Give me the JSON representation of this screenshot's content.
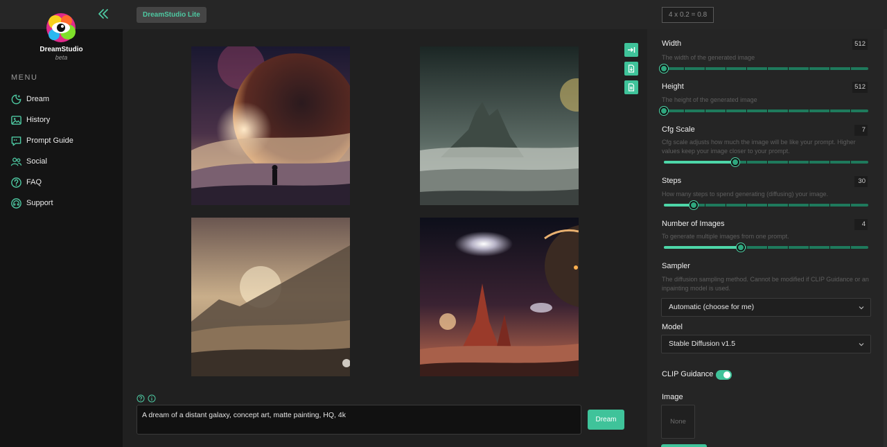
{
  "sidebar": {
    "brand": "DreamStudio",
    "brand_sub": "beta",
    "menu_label": "MENU",
    "items": [
      {
        "label": "Dream",
        "icon": "dream-icon"
      },
      {
        "label": "History",
        "icon": "history-icon"
      },
      {
        "label": "Prompt Guide",
        "icon": "prompt-guide-icon"
      },
      {
        "label": "Social",
        "icon": "social-icon"
      },
      {
        "label": "FAQ",
        "icon": "faq-icon"
      },
      {
        "label": "Support",
        "icon": "support-icon"
      }
    ]
  },
  "topbar": {
    "tag": "DreamStudio Lite",
    "formula": "4 x 0.2 = 0.8"
  },
  "prompt": {
    "text": "A dream of a distant galaxy, concept art, matte painting, HQ, 4k",
    "dream_button": "Dream"
  },
  "settings": {
    "width": {
      "title": "Width",
      "desc": "The width of the generated image",
      "value": "512",
      "fraction": 0
    },
    "height": {
      "title": "Height",
      "desc": "The height of the generated image",
      "value": "512",
      "fraction": 0
    },
    "cfg": {
      "title": "Cfg Scale",
      "desc": "Cfg scale adjusts how much the image will be like your prompt. Higher values keep your image closer to your prompt.",
      "value": "7",
      "fraction": 0.35
    },
    "steps": {
      "title": "Steps",
      "desc": "How many steps to spend generating (diffusing) your image.",
      "value": "30",
      "fraction": 0.145
    },
    "images": {
      "title": "Number of Images",
      "desc": "To generate multiple images from one prompt.",
      "value": "4",
      "fraction": 0.375
    },
    "sampler": {
      "title": "Sampler",
      "desc": "The diffusion sampling method. Cannot be modified if CLIP Guidance or an inpainting model is used.",
      "value": "Automatic (choose for me)"
    },
    "model": {
      "title": "Model",
      "value": "Stable Diffusion v1.5"
    },
    "clip": {
      "title": "CLIP Guidance",
      "enabled": true
    },
    "image": {
      "title": "Image",
      "placeholder": "None"
    }
  },
  "colors": {
    "accent": "#3fc39a",
    "panel": "#252525",
    "sidebar": "#141414"
  }
}
